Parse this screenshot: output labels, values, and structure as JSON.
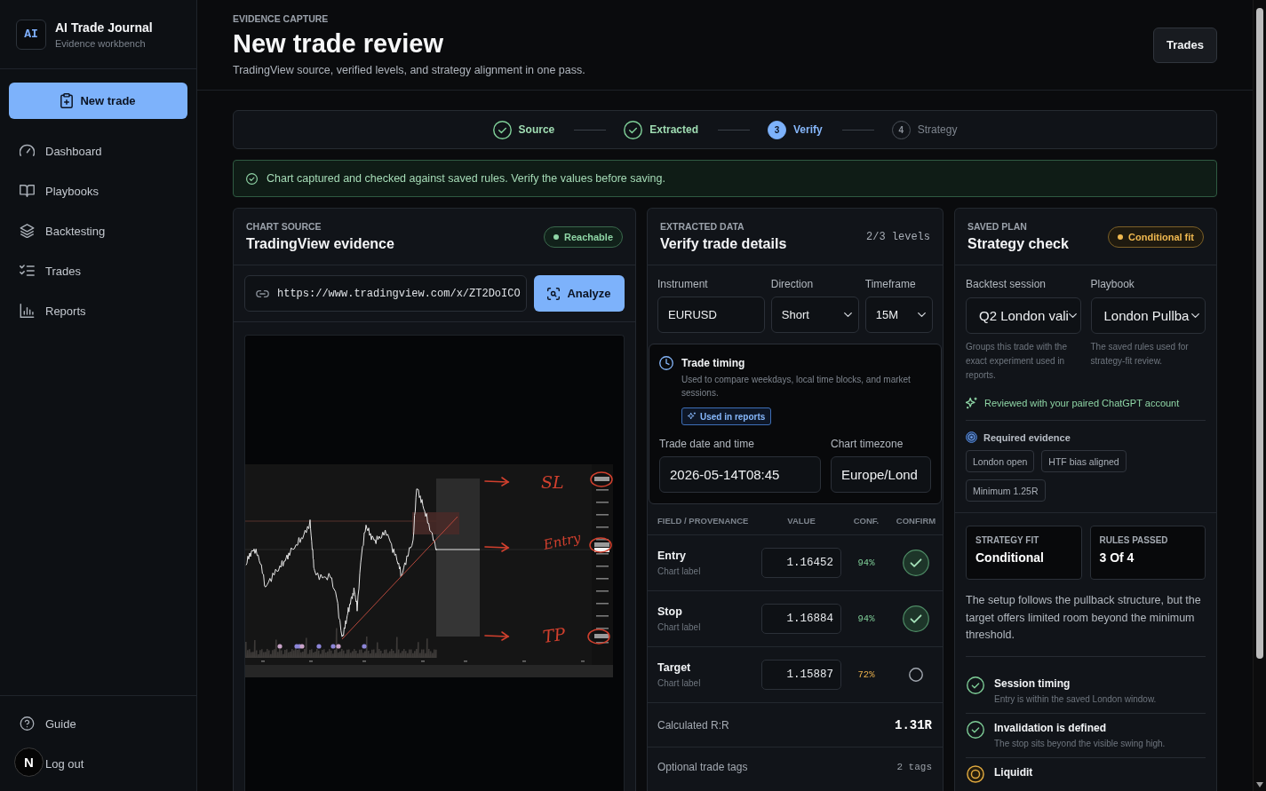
{
  "sidebar": {
    "brand": {
      "logo": "AI",
      "title": "AI Trade Journal",
      "subtitle": "Evidence workbench"
    },
    "new_button": "New trade",
    "nav": [
      {
        "label": "Dashboard",
        "selected": false
      },
      {
        "label": "Playbooks",
        "selected": false
      },
      {
        "label": "Backtesting",
        "selected": false
      },
      {
        "label": "Trades",
        "selected": false
      },
      {
        "label": "Reports",
        "selected": false
      }
    ],
    "footer": [
      {
        "label": "Guide"
      },
      {
        "label": "Log out"
      }
    ]
  },
  "dev_badge": "N",
  "header": {
    "eyebrow": "EVIDENCE CAPTURE",
    "title": "New trade review",
    "subtitle": "TradingView source, verified levels, and strategy alignment in one pass.",
    "button": "Trades"
  },
  "steps": [
    {
      "label": "Source",
      "completed": true,
      "selected": false
    },
    {
      "label": "Extracted",
      "completed": true,
      "selected": false
    },
    {
      "label": "Verify",
      "number": "3",
      "completed": false,
      "selected": true
    },
    {
      "label": "Strategy",
      "number": "4",
      "completed": false,
      "selected": false
    }
  ],
  "alert": "Chart captured and checked against saved rules. Verify the values before saving.",
  "chart_source": {
    "eyebrow": "CHART SOURCE",
    "title": "TradingView evidence",
    "status": {
      "label": "Reachable",
      "warning": false
    },
    "url": "https://www.tradingview.com/x/ZT2DoICO",
    "button": "Analyze",
    "annotations": [
      "SL",
      "Entry",
      "TP"
    ]
  },
  "extracted": {
    "eyebrow": "EXTRACTED DATA",
    "title": "Verify trade details",
    "count": "2/3 levels",
    "fields": [
      {
        "label": "Instrument",
        "value": "EURUSD",
        "kind": "text"
      },
      {
        "label": "Direction",
        "value": "Short",
        "kind": "select"
      },
      {
        "label": "Timeframe",
        "value": "15M",
        "kind": "select"
      }
    ],
    "timing": {
      "title": "Trade timing",
      "description": "Used to compare weekdays, local time blocks, and market sessions.",
      "chip": "Used in reports",
      "fields": [
        {
          "label": "Trade date and time",
          "value": "2026-05-14T08:45"
        },
        {
          "label": "Chart timezone",
          "value": "Europe/Lond"
        }
      ]
    },
    "table": {
      "columns": [
        "FIELD / PROVENANCE",
        "VALUE",
        "CONF.",
        "CONFIRM"
      ],
      "rows": [
        {
          "field": "Entry",
          "source": "Chart label",
          "value": "1.16452",
          "confidence": "94%",
          "warning": false,
          "confirmed": true
        },
        {
          "field": "Stop",
          "source": "Chart label",
          "value": "1.16884",
          "confidence": "94%",
          "warning": false,
          "confirmed": true
        },
        {
          "field": "Target",
          "source": "Chart label",
          "value": "1.15887",
          "confidence": "72%",
          "warning": true,
          "confirmed": false
        }
      ]
    },
    "rr": {
      "label": "Calculated R:R",
      "value": "1.31R"
    },
    "tags": {
      "label": "Optional trade tags",
      "count": "2 tags"
    }
  },
  "strategy": {
    "eyebrow": "SAVED PLAN",
    "title": "Strategy check",
    "status": {
      "label": "Conditional fit",
      "warning": true
    },
    "selects": [
      {
        "label": "Backtest session",
        "value": "Q2 London vali",
        "help": "Groups this trade with the exact experiment used in reports."
      },
      {
        "label": "Playbook",
        "value": "London Pullba",
        "help": "The saved rules used for strategy-fit review."
      }
    ],
    "review_note": "Reviewed with your paired ChatGPT account",
    "evidence": {
      "title": "Required evidence",
      "tags": [
        "London open",
        "HTF bias aligned",
        "Minimum 1.25R"
      ]
    },
    "stats": [
      {
        "label": "STRATEGY FIT",
        "value": "Conditional"
      },
      {
        "label": "RULES PASSED",
        "value": "3 Of 4"
      }
    ],
    "summary": "The setup follows the pullback structure, but the target offers limited room beyond the minimum threshold.",
    "rules": [
      {
        "title": "Session timing",
        "detail": "Entry is within the saved London window.",
        "passed": true
      },
      {
        "title": "Invalidation is defined",
        "detail": "The stop sits beyond the visible swing high.",
        "passed": true
      },
      {
        "title": "Liquidit",
        "passed": false
      }
    ]
  }
}
